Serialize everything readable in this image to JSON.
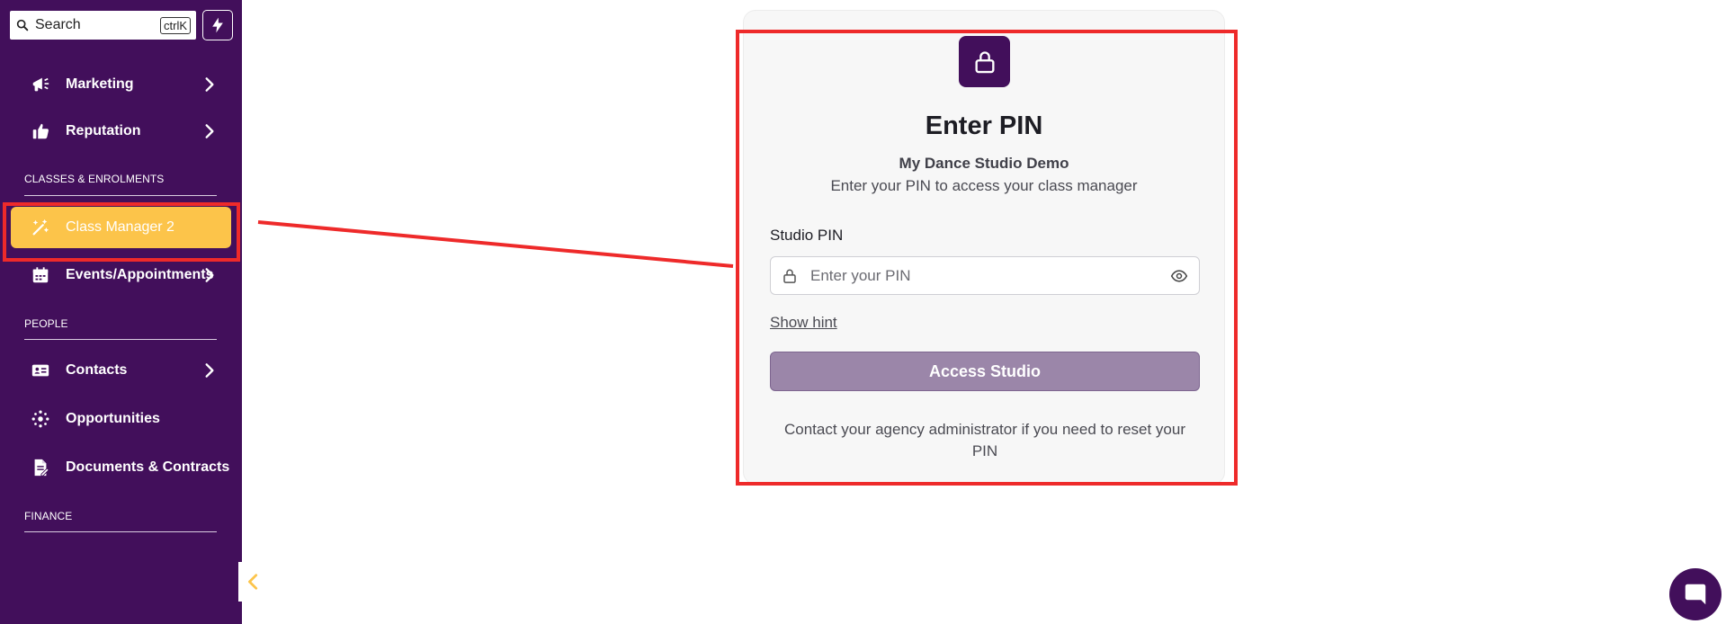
{
  "search": {
    "label": "Search",
    "shortcut": "ctrlK"
  },
  "sidebar": {
    "items": [
      {
        "label": "Marketing",
        "icon": "megaphone-icon"
      },
      {
        "label": "Reputation",
        "icon": "thumbs-up-icon"
      },
      {
        "label": "Class Manager 2",
        "icon": "magic-wand-icon",
        "active": true
      },
      {
        "label": "Events/Appointments",
        "icon": "calendar-icon"
      },
      {
        "label": "Contacts",
        "icon": "contact-card-icon"
      },
      {
        "label": "Opportunities",
        "icon": "opportunities-icon"
      },
      {
        "label": "Documents & Contracts",
        "icon": "document-icon"
      }
    ],
    "sections": {
      "classes": "CLASSES & ENROLMENTS",
      "people": "PEOPLE",
      "finance": "FINANCE"
    }
  },
  "card": {
    "title": "Enter PIN",
    "studio_name": "My Dance Studio Demo",
    "subtitle": "Enter your PIN to access your class manager",
    "pin_label": "Studio PIN",
    "pin_placeholder": "Enter your PIN",
    "show_hint": "Show hint",
    "access_button": "Access Studio",
    "footer_note": "Contact your agency administrator if you need to reset your PIN"
  },
  "colors": {
    "sidebar_bg": "#420f5b",
    "active_item": "#fcc44a",
    "button_bg": "#9b86a9",
    "highlight": "#ee2a2a"
  }
}
